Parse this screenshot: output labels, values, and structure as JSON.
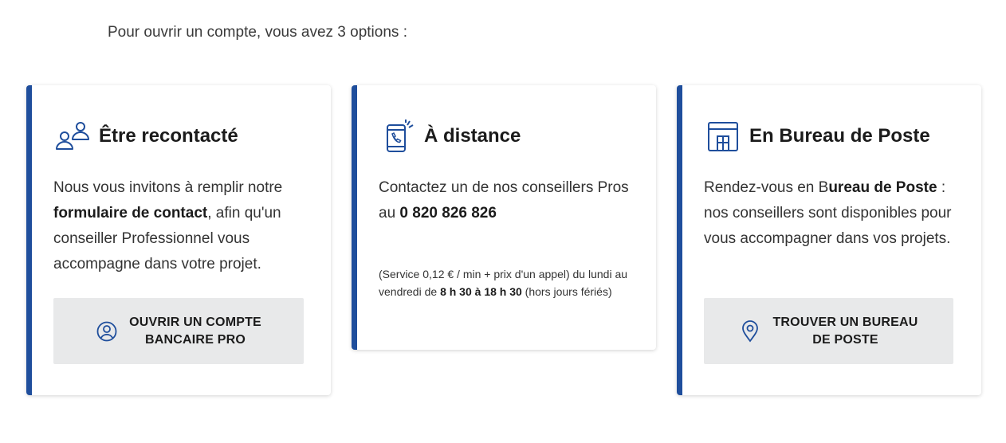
{
  "intro": "Pour ouvrir un compte, vous avez 3 options :",
  "colors": {
    "accent": "#1f4e9c",
    "button_bg": "#e8e9ea"
  },
  "cards": [
    {
      "title": "Être recontacté",
      "icon": "people-icon",
      "text_1": "Nous vous invitons à remplir notre ",
      "text_bold": "formulaire de contact",
      "text_2": ", afin qu'un conseiller Professionnel vous accompagne dans votre projet.",
      "button": {
        "label": "OUVRIR UN COMPTE\nBANCAIRE PRO",
        "icon": "user-circle-icon"
      }
    },
    {
      "title": "À distance",
      "icon": "phone-call-icon",
      "text_1": "Contactez un de nos conseillers Pros au ",
      "text_bold": "0 820 826 826",
      "note_1": "(Service 0,12 € / min + prix d'un appel) du lundi au vendredi de ",
      "note_bold": "8 h 30 à 18 h 30",
      "note_2": " (hors jours fériés)"
    },
    {
      "title": "En Bureau de Poste",
      "icon": "post-office-icon",
      "text_1": "Rendez-vous en B",
      "text_bold": "ureau de Poste",
      "text_2": " : nos conseillers sont disponibles pour vous accompagner dans vos projets.",
      "button": {
        "label": "TROUVER UN BUREAU\nDE POSTE",
        "icon": "location-pin-icon"
      }
    }
  ]
}
